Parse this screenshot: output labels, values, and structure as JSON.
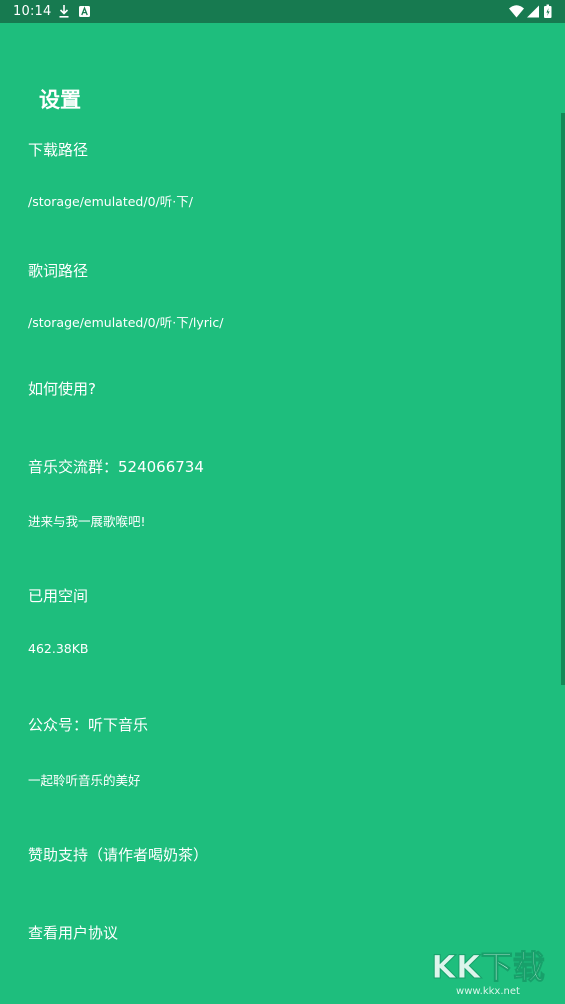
{
  "status_bar": {
    "time": "10:14",
    "left_icons": [
      "download-icon",
      "a-square-icon"
    ],
    "right_icons": [
      "wifi-icon",
      "signal-icon",
      "battery-icon"
    ]
  },
  "page": {
    "title": "设置"
  },
  "settings": [
    {
      "title": "下载路径",
      "subtitle": "/storage/emulated/0/听·下/"
    },
    {
      "title": "歌词路径",
      "subtitle": "/storage/emulated/0/听·下/lyric/"
    },
    {
      "title": "如何使用?"
    },
    {
      "title": "音乐交流群：524066734",
      "subtitle": "进来与我一展歌喉吧!"
    },
    {
      "title": "已用空间",
      "subtitle": "462.38KB"
    },
    {
      "title": "公众号：听下音乐",
      "subtitle": "一起聆听音乐的美好"
    },
    {
      "title": "赞助支持（请作者喝奶茶）"
    },
    {
      "title": "查看用户协议"
    }
  ],
  "watermark": {
    "logo_text": "KK下载",
    "url": "www.kkx.net"
  },
  "colors": {
    "background": "#1ebe7d",
    "status_bar": "#177a50",
    "text": "#ffffff",
    "scrollbar": "#128a57"
  }
}
